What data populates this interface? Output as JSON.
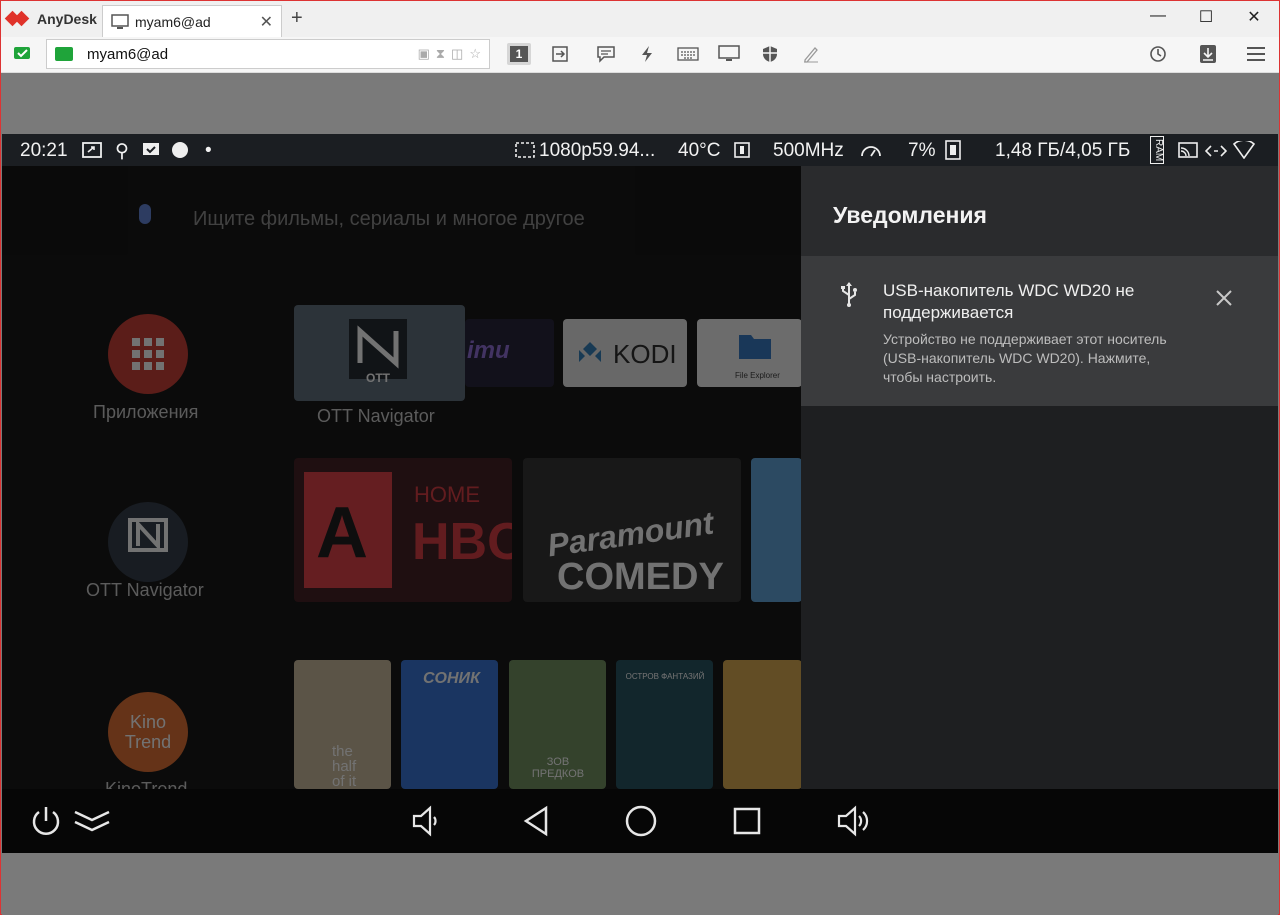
{
  "app": {
    "name": "AnyDesk"
  },
  "tab": {
    "title": "myam6@ad",
    "close": "✕",
    "new_tab": "+"
  },
  "window_controls": {
    "minimize": "—",
    "maximize": "☐",
    "close": "✕"
  },
  "address": {
    "value": "myam6@ad"
  },
  "toolbar": {
    "display_badge": "1"
  },
  "status_bar": {
    "time": "20:21",
    "resolution": "1080p59.94...",
    "temperature": "40°C",
    "cpu_freq": "500MHz",
    "cpu_load": "7%",
    "memory": "1,48 ГБ/4,05 ГБ",
    "ram_label": "RAM"
  },
  "home": {
    "search_placeholder": "Ищите фильмы, сериалы и многое другое",
    "apps_label": "Приложения",
    "ott_label": "OTT Navigator",
    "ott_label_left": "OTT Navigator",
    "kinotrend_label": "KinoTrend",
    "kinotrend_logo": "Kino Trend",
    "kodi_label": "KODI",
    "file_explorer_label": "File Explorer",
    "mu_label": "imu",
    "ott_tile_text": "OTT",
    "hbo_text": "HBO",
    "home_text": "HOME",
    "paramount_text": "Paramount",
    "comedy_text": "COMEDY",
    "poster1_text": "the half of it",
    "poster2_title": "СОНИК",
    "poster3_text": "ЗОВ ПРЕДКОВ",
    "poster4_text": "ОСТРОВ ФАНТАЗИЙ"
  },
  "notifications": {
    "title": "Уведомления",
    "items": [
      {
        "title": "USB-накопитель WDC WD20 не поддерживается",
        "text": "Устройство не поддерживает этот носитель (USB-накопитель WDC WD20). Нажмите, чтобы настроить."
      }
    ]
  },
  "colors": {
    "accent_red": "#e0322a",
    "status_green": "#1fa43a",
    "panel_bg": "#1e1f21",
    "card_bg": "#3a3b3d"
  }
}
